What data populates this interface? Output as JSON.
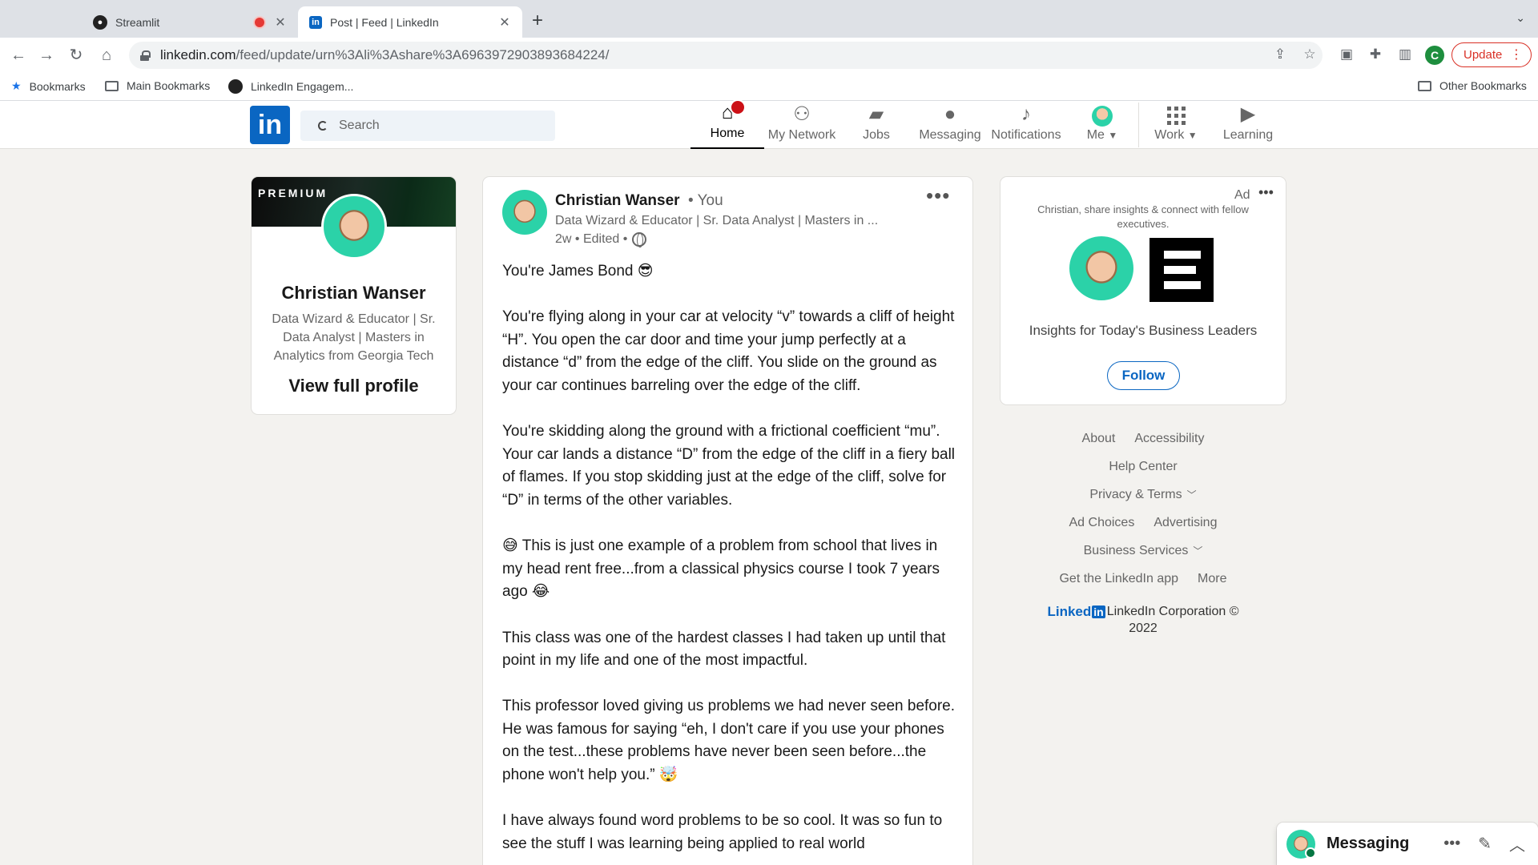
{
  "browser": {
    "tabs": [
      {
        "title": "Streamlit"
      },
      {
        "title": "Post | Feed | LinkedIn"
      }
    ],
    "url_domain": "linkedin.com",
    "url_path": "/feed/update/urn%3Ali%3Ashare%3A6963972903893684224/",
    "update_label": "Update",
    "profile_initial": "C",
    "bookmarks": [
      "Bookmarks",
      "Main Bookmarks",
      "LinkedIn Engagem..."
    ],
    "other_bookmarks": "Other Bookmarks"
  },
  "linkedin_nav": {
    "logo": "in",
    "search_placeholder": "Search",
    "notification_badge": "",
    "items": [
      {
        "label": "Home"
      },
      {
        "label": "My Network"
      },
      {
        "label": "Jobs"
      },
      {
        "label": "Messaging"
      },
      {
        "label": "Notifications"
      },
      {
        "label": "Me"
      },
      {
        "label": "Work"
      },
      {
        "label": "Learning"
      }
    ]
  },
  "profile_card": {
    "banner_text": "PREMIUM",
    "name": "Christian Wanser",
    "headline": "Data Wizard & Educator | Sr. Data Analyst | Masters in Analytics from Georgia Tech",
    "view_profile": "View full profile"
  },
  "post": {
    "author": "Christian Wanser",
    "author_tag": "• You",
    "headline": "Data Wizard & Educator | Sr. Data Analyst | Masters in ...",
    "meta": "2w • Edited •",
    "more_label": "•••",
    "paragraphs": [
      "You're James Bond 😎",
      "You're flying along in your car at velocity “v” towards a cliff of height “H”. You open the car door and time your jump perfectly at a distance “d” from the edge of the cliff. You slide on the ground as your car continues barreling over the edge of the cliff.",
      "You're skidding along the ground with a frictional coefficient “mu”. Your car lands a distance “D” from the edge of the cliff in a fiery ball of flames. If you stop skidding just at the edge of the cliff, solve for “D” in terms of the other variables.",
      "😅 This is just one example of a problem from school that lives in my head rent free...from a classical physics course I took 7 years ago 😂",
      "This class was one of the hardest classes I had taken up until that point in my life and one of the most impactful.",
      "This professor loved giving us problems we had never seen before. He was famous for saying “eh, I don't care if you use your phones on the test...these problems have never been seen before...the phone won't help you.” 🤯",
      "I have always found word problems to be so cool. It was so fun to see the stuff I was learning being applied to real world"
    ]
  },
  "ad": {
    "label": "Ad",
    "more_label": "•••",
    "text": "Christian, share insights & connect with fellow executives.",
    "title": "Insights for Today's Business Leaders",
    "follow": "Follow"
  },
  "footer": {
    "row1": [
      "About",
      "Accessibility"
    ],
    "row2": [
      "Help Center"
    ],
    "row3": [
      "Privacy & Terms"
    ],
    "row4": [
      "Ad Choices",
      "Advertising"
    ],
    "row5": [
      "Business Services"
    ],
    "row6": [
      "Get the LinkedIn app",
      "More"
    ],
    "brand_word": "Linked",
    "brand_in": "in",
    "copyright_a": "LinkedIn Corporation ©",
    "copyright_b": "2022"
  },
  "messaging": {
    "title": "Messaging",
    "more_label": "•••"
  },
  "colors": {
    "linkedin_blue": "#0a66c2",
    "notification_red": "#cc1016",
    "page_bg": "#f3f2ef"
  }
}
